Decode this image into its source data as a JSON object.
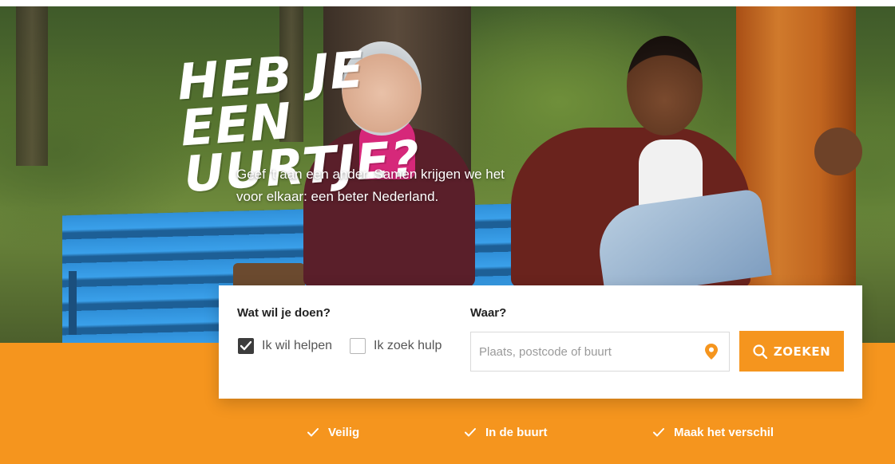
{
  "hero": {
    "headline_line1": "HEB JE EEN",
    "headline_line2": "UURTJE?",
    "subline_line1": "Geef 't aan een ander. Samen krijgen we het",
    "subline_line2": "voor elkaar: een beter Nederland."
  },
  "search": {
    "what_label": "Wat wil je doen?",
    "where_label": "Waar?",
    "options": [
      {
        "label": "Ik wil helpen",
        "checked": true
      },
      {
        "label": "Ik zoek hulp",
        "checked": false
      }
    ],
    "location_placeholder": "Plaats, postcode of buurt",
    "location_value": "",
    "button_label": "ZOEKEN"
  },
  "usps": [
    {
      "label": "Veilig"
    },
    {
      "label": "In de buurt"
    },
    {
      "label": "Maak het verschil"
    }
  ],
  "colors": {
    "brand_orange": "#f5951e",
    "white": "#ffffff",
    "checkbox_checked": "#3c3c3c"
  },
  "icons": [
    "checkmark-icon",
    "location-pin-icon",
    "search-icon"
  ]
}
